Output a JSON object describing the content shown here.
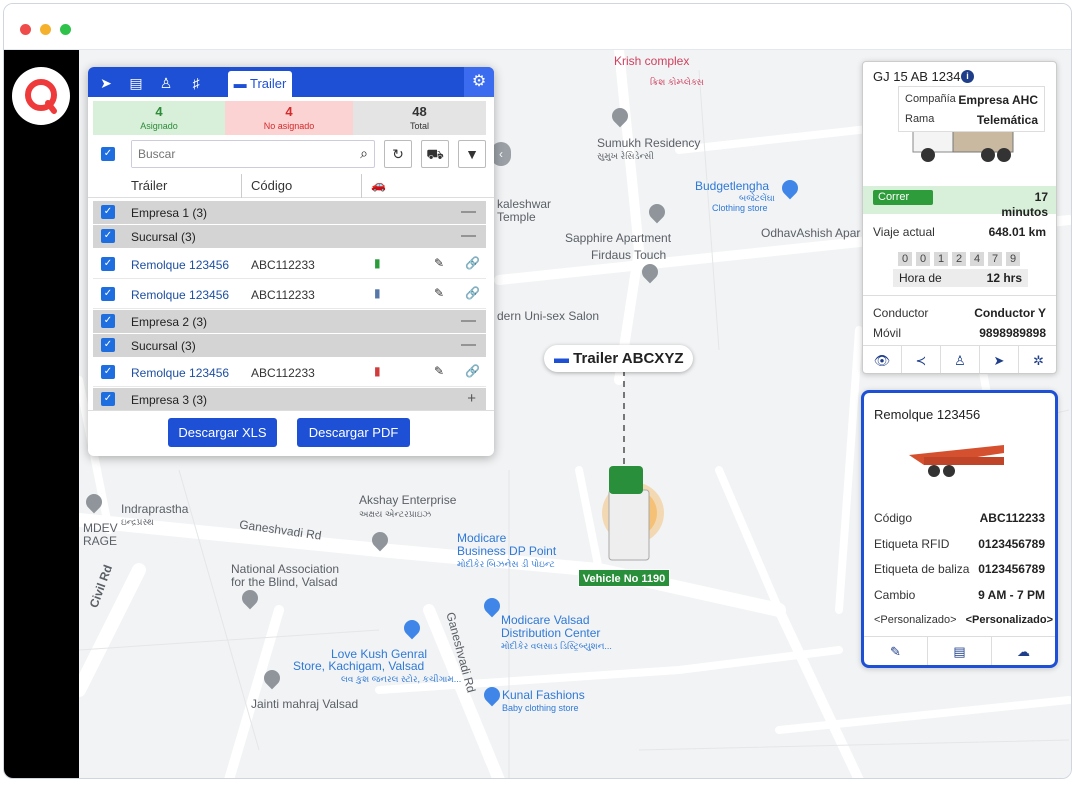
{
  "panel": {
    "active_tab": "Trailer",
    "stats": [
      {
        "n": "4",
        "l": "Asignado"
      },
      {
        "n": "4",
        "l": "No asignado"
      },
      {
        "n": "48",
        "l": "Total"
      }
    ],
    "search_placeholder": "Buscar",
    "headers": {
      "trailer": "Tráiler",
      "code": "Código"
    },
    "groups": [
      {
        "label": "Empresa 1 (3)",
        "sign": "—"
      },
      {
        "label": "Sucursal (3)",
        "sign": "—"
      },
      {
        "label": "Empresa 2 (3)",
        "sign": "—"
      },
      {
        "label": "Sucursal (3)",
        "sign": "—"
      },
      {
        "label": "Empresa 3 (3)",
        "sign": "+"
      }
    ],
    "rows": [
      {
        "name": "Remolque 123456",
        "code": "ABC112233"
      },
      {
        "name": "Remolque 123456",
        "code": "ABC112233"
      },
      {
        "name": "Remolque 123456",
        "code": "ABC112233"
      }
    ],
    "btn_xls": "Descargar XLS",
    "btn_pdf": "Descargar PDF"
  },
  "vehicle_card": {
    "plate": "GJ 15 AB 1234",
    "company_label": "Compañía",
    "company_value": "Empresa AHC",
    "branch_label": "Rama",
    "branch_value": "Telemática",
    "status": "Correr",
    "status_time": "17 minutos",
    "trip_label": "Viaje actual",
    "trip_value": "648.01 km",
    "odometer": [
      "0",
      "0",
      "1",
      "2",
      "4",
      "7",
      "9"
    ],
    "hours_label": "Hora de",
    "hours_value": "12 hrs",
    "driver_label": "Conductor",
    "driver_value": "Conductor Y",
    "mobile_label": "Móvil",
    "mobile_value": "9898989898"
  },
  "trailer_card": {
    "title": "Remolque 123456",
    "code_label": "Código",
    "code_value": "ABC112233",
    "rfid_label": "Etiqueta RFID",
    "rfid_value": "0123456789",
    "beacon_label": "Etiqueta de baliza",
    "beacon_value": "0123456789",
    "change_label": "Cambio",
    "change_value": "9 AM - 7 PM",
    "custom_label": "<Personalizado>",
    "custom_value": "<Personalizado>"
  },
  "map": {
    "trailer_pill": "Trailer ABCXYZ",
    "vehicle_label": "Vehicle No 1190",
    "labels": {
      "krish": "Krish complex",
      "krish_g": "ક્રિશ કોમ્પ્લેક્સ",
      "sumukh": "Sumukh Residency",
      "sumukh_g": "સુમુખ રેસિડેન્સી",
      "budget": "Budgetlengha",
      "budget_g": "બજેટલેંઘા",
      "clothing": "Clothing store",
      "kaleshwar": "kaleshwar",
      "temple": "Temple",
      "sapphire": "Sapphire Apartment",
      "firdaus": "Firdaus Touch",
      "odhav": "OdhavAshish Apar",
      "unisex": "dern Uni-sex Salon",
      "akshay": "Akshay Enterprise",
      "akshay_g": "અક્ષય એન્ટરપ્રાઇઝ",
      "indraprastha": "Indraprastha",
      "indra_g": "ઇન્દ્રપ્રસ્થ",
      "ganesh": "Ganeshvadi Rd",
      "civil": "Civil Rd",
      "modicare": "Modicare",
      "modicare2": "Business DP Point",
      "modicare_g": "મોદીકેર બિઝનેસ ડી પોઇન્ટ",
      "nab": "National Association",
      "nab2": "for the Blind, Valsad",
      "valsad": "Modicare Valsad",
      "valsad2": "Distribution Center",
      "valsad_g": "મોદીકેર વલસાડ ડિસ્ટ્રિબ્યુશન...",
      "lovekush": "Love Kush Genral",
      "lovekush2": "Store, Kachigam, Valsad",
      "lovekush_g": "લવ કુશ જનરલ સ્ટોર, કચીગામ...",
      "kunal": "Kunal Fashions",
      "kunal2": "Baby clothing store",
      "jainti": "Jainti mahraj Valsad",
      "ganesh2": "Ganeshvadi Rd",
      "mdev": "MDEV",
      "rage": "RAGE"
    }
  }
}
